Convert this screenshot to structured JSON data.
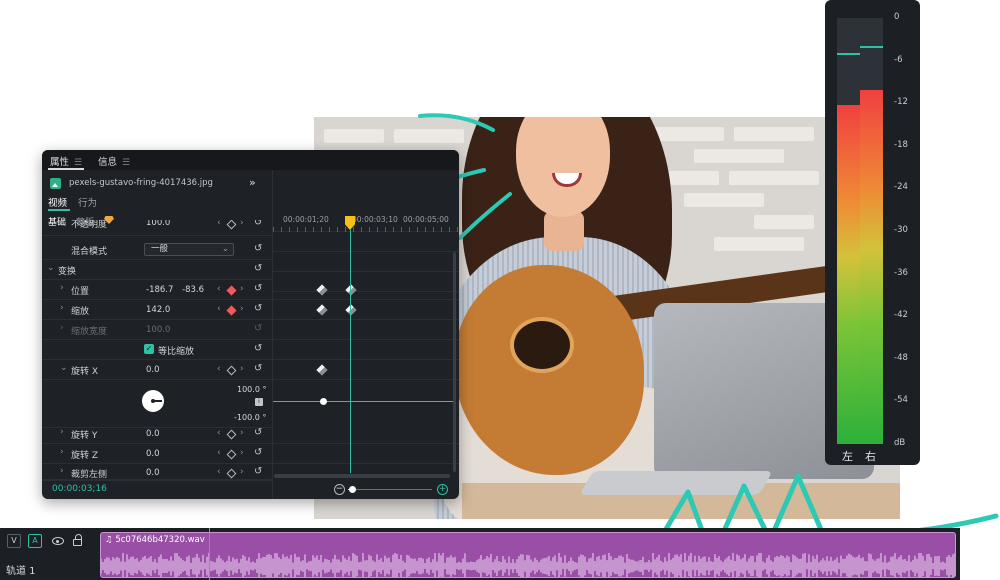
{
  "panel": {
    "tabs": [
      {
        "label": "属性",
        "menu_icon": "menu-icon"
      },
      {
        "label": "信息",
        "menu_icon": "menu-icon"
      }
    ],
    "file_name": "pexels-gustavo-fring-4017436.jpg",
    "expand_label": "»",
    "sub_tabs": [
      "视频",
      "行为"
    ],
    "sub_tabs2": [
      "基础",
      "蒙版"
    ],
    "properties": {
      "opacity": {
        "label": "不透明度",
        "value": "100.0"
      },
      "blend_mode": {
        "label": "混合模式",
        "value": "一般"
      },
      "transform": {
        "label": "变换"
      },
      "position": {
        "label": "位置",
        "x": "-186.7",
        "y": "-83.6"
      },
      "scale": {
        "label": "缩放",
        "value": "142.0"
      },
      "scale_width": {
        "label": "缩放宽度",
        "value": "100.0"
      },
      "uniform_scale": {
        "label": "等比缩放",
        "checked": true
      },
      "rotate_x": {
        "label": "旋转 X",
        "value": "0.0"
      },
      "rotate_max": "100.0 °",
      "rotate_min": "-100.0 °",
      "rotate_y": {
        "label": "旋转 Y",
        "value": "0.0"
      },
      "rotate_z": {
        "label": "旋转 Z",
        "value": "0.0"
      },
      "crop_left": {
        "label": "裁剪左侧",
        "value": "0.0"
      }
    },
    "timecode": "00:00:03;16",
    "ruler_labels": [
      "00:00:01;20",
      "00:00:03;10",
      "00:00:05;00"
    ]
  },
  "meter": {
    "db_labels": [
      "0",
      "-6",
      "-12",
      "-18",
      "-24",
      "-30",
      "-36",
      "-42",
      "-48",
      "-54",
      "dB"
    ],
    "left_label": "左",
    "right_label": "右",
    "left_level_db": -12.3,
    "right_level_db": -10.1,
    "left_peak_db": -4.9,
    "right_peak_db": -3.9
  },
  "track": {
    "buttons": [
      "V",
      "A"
    ],
    "name": "轨道 1",
    "clip_name": "5c07646b47320.wav"
  },
  "colors": {
    "accent": "#2fc0a5",
    "keyframe_active": "#f05a5a",
    "playhead": "#f3c01a",
    "audio_clip": "#9a4fa6",
    "panel_bg": "#1e2126"
  }
}
